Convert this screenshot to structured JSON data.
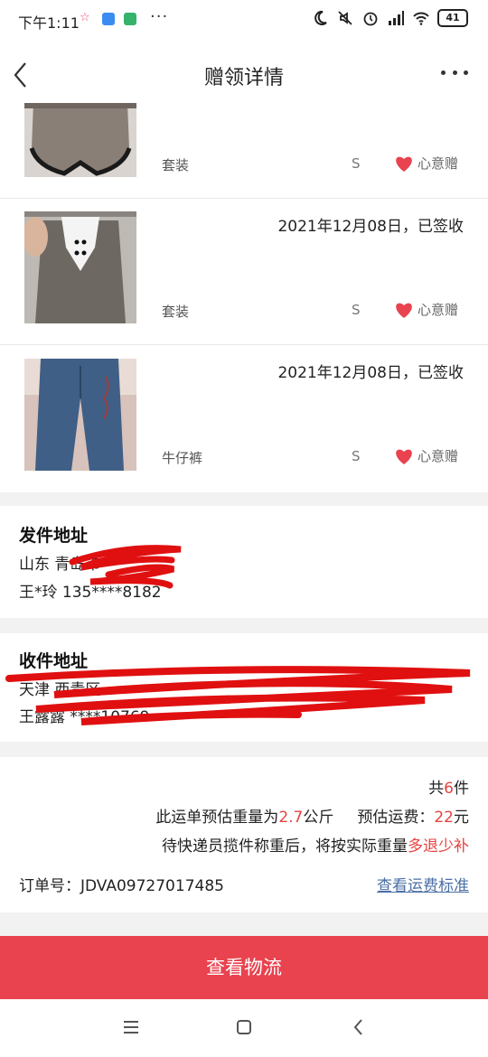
{
  "status_bar": {
    "time": "下午1:11",
    "star": "☆",
    "more": "···",
    "battery": "41"
  },
  "header": {
    "title": "赠领详情"
  },
  "items": [
    {
      "date": "",
      "name": "套装",
      "size": "S",
      "gift_label": "心意赠"
    },
    {
      "date": "2021年12月08日，已签收",
      "name": "套装",
      "size": "S",
      "gift_label": "心意赠"
    },
    {
      "date": "2021年12月08日，已签收",
      "name": "牛仔裤",
      "size": "S",
      "gift_label": "心意赠"
    }
  ],
  "sender": {
    "title": "发件地址",
    "line1": "山东 青岛市",
    "line2": "王*玲 135****8182"
  },
  "receiver": {
    "title": "收件地址",
    "line1": "天津 西青区",
    "line2": "王露露 ****10769"
  },
  "summary": {
    "count_prefix": "共",
    "count": "6",
    "count_suffix": "件",
    "weight_prefix": "此运单预估重量为",
    "weight": "2.7",
    "weight_unit": "公斤",
    "fee_prefix": "预估运费：",
    "fee": "22",
    "fee_unit": "元",
    "note_prefix": "待快递员揽件称重后，将按实际重量",
    "note_highlight": "多退少补",
    "order_label": "订单号：",
    "order_no": "JDVA09727017485",
    "fee_standard_link": "查看运费标准"
  },
  "bottom_button": {
    "label": "查看物流"
  },
  "colors": {
    "accent_red": "#e64340",
    "button_red": "#e8434f",
    "link_blue": "#4a6fa5",
    "heart": "#e8434f"
  }
}
